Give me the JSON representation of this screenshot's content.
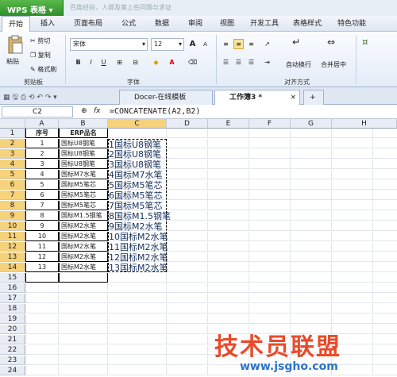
{
  "title_bar": {
    "app_button": "WPS 表格",
    "doc_title": "百度经验，人绑及第上在问题与求证"
  },
  "menu": {
    "items": [
      "开始",
      "插入",
      "页面布局",
      "公式",
      "数据",
      "审阅",
      "视图",
      "开发工具",
      "表格样式",
      "特色功能"
    ]
  },
  "ribbon": {
    "paste": "粘贴",
    "cut": "剪切",
    "copy": "复制",
    "format_painter": "格式刷",
    "clipboard_group": "剪贴板",
    "font_name": "宋体",
    "font_size": "12",
    "font_group": "字体",
    "wrap_text": "自动换行",
    "merge_center": "合并居中",
    "align_group": "对齐方式",
    "bold": "B",
    "italic": "I",
    "underline": "U",
    "grow_font": "A",
    "shrink_font": "A"
  },
  "tabs": {
    "doc1": "Docer-在线模板",
    "doc2": "工作簿3 *",
    "add": "+"
  },
  "formula_bar": {
    "cell_ref": "C2",
    "fx": "fx",
    "formula": "=CONCATENATE(A2,B2)"
  },
  "sheet": {
    "columns": [
      "A",
      "B",
      "C",
      "D",
      "E",
      "F",
      "G",
      "H"
    ],
    "rows": [
      "1",
      "2",
      "3",
      "4",
      "5",
      "6",
      "7",
      "8",
      "9",
      "10",
      "11",
      "12",
      "13",
      "14",
      "15",
      "16",
      "17",
      "18",
      "19",
      "20",
      "21",
      "22",
      "23",
      "24"
    ],
    "header_a": "序号",
    "header_b": "ERP品名",
    "data": [
      {
        "a": "1",
        "b": "国标U8钢笔",
        "c": "1国标U8钢笔"
      },
      {
        "a": "2",
        "b": "国标U8钢笔",
        "c": "2国标U8钢笔"
      },
      {
        "a": "3",
        "b": "国标U8钢笔",
        "c": "3国标U8钢笔"
      },
      {
        "a": "4",
        "b": "国标M7水笔",
        "c": "4国标M7水笔"
      },
      {
        "a": "5",
        "b": "国标M5笔芯",
        "c": "5国标M5笔芯"
      },
      {
        "a": "6",
        "b": "国标M5笔芯",
        "c": "6国标M5笔芯"
      },
      {
        "a": "7",
        "b": "国标M5笔芯",
        "c": "7国标M5笔芯"
      },
      {
        "a": "8",
        "b": "国标M1.5钢笔",
        "c": "8国标M1.5钢笔"
      },
      {
        "a": "9",
        "b": "国标M2水笔",
        "c": "9国标M2水笔"
      },
      {
        "a": "10",
        "b": "国标M2水笔",
        "c": "10国标M2水笔"
      },
      {
        "a": "11",
        "b": "国标M2水笔",
        "c": "11国标M2水笔"
      },
      {
        "a": "12",
        "b": "国标M2水笔",
        "c": "12国标M2水笔"
      },
      {
        "a": "13",
        "b": "国标M2水笔",
        "c": "13国标M2水笔"
      }
    ]
  },
  "watermark": {
    "brand": "技术员联盟",
    "url": "www.jsgho.com"
  },
  "colors": {
    "accent_green": "#2f8f2a",
    "selection": "#f6d27a",
    "watermark_red": "#e94b2a",
    "watermark_blue": "#2c73c9"
  }
}
